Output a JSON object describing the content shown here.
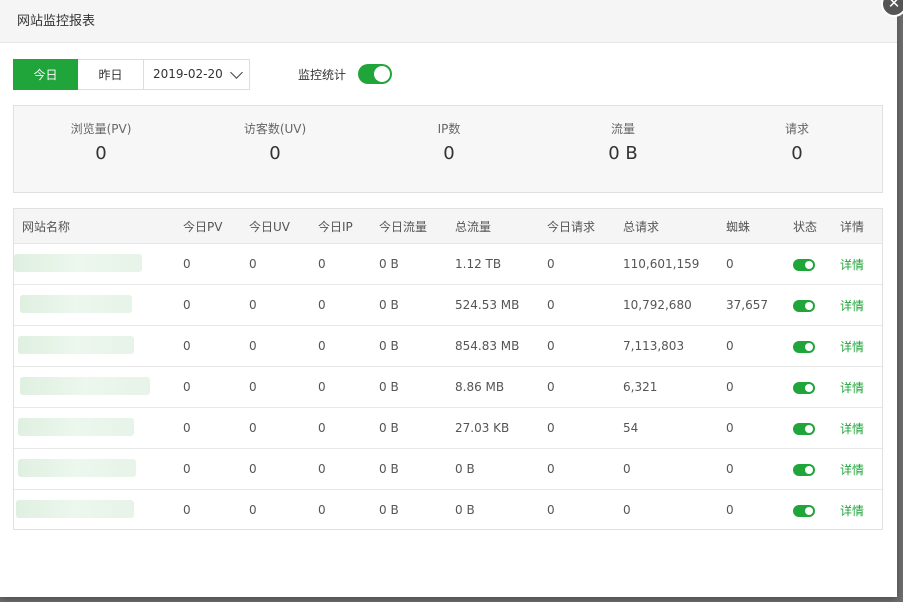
{
  "dialog": {
    "title": "网站监控报表"
  },
  "toolbar": {
    "today_label": "今日",
    "yesterday_label": "昨日",
    "date_value": "2019-02-20",
    "monitor_label": "监控统计",
    "monitor_enabled": true
  },
  "stats": [
    {
      "label": "浏览量(PV)",
      "value": "0"
    },
    {
      "label": "访客数(UV)",
      "value": "0"
    },
    {
      "label": "IP数",
      "value": "0"
    },
    {
      "label": "流量",
      "value": "0 B"
    },
    {
      "label": "请求",
      "value": "0"
    }
  ],
  "table": {
    "headers": [
      "网站名称",
      "今日PV",
      "今日UV",
      "今日IP",
      "今日流量",
      "总流量",
      "今日请求",
      "总请求",
      "蜘蛛",
      "状态",
      "详情"
    ],
    "rows": [
      {
        "pv": "0",
        "uv": "0",
        "ip": "0",
        "today_traffic": "0 B",
        "total_traffic": "1.12 TB",
        "today_requests": "0",
        "total_requests": "110,601,159",
        "spiders": "0",
        "status": true,
        "detail": "详情"
      },
      {
        "pv": "0",
        "uv": "0",
        "ip": "0",
        "today_traffic": "0 B",
        "total_traffic": "524.53 MB",
        "today_requests": "0",
        "total_requests": "10,792,680",
        "spiders": "37,657",
        "status": true,
        "detail": "详情"
      },
      {
        "pv": "0",
        "uv": "0",
        "ip": "0",
        "today_traffic": "0 B",
        "total_traffic": "854.83 MB",
        "today_requests": "0",
        "total_requests": "7,113,803",
        "spiders": "0",
        "status": true,
        "detail": "详情"
      },
      {
        "pv": "0",
        "uv": "0",
        "ip": "0",
        "today_traffic": "0 B",
        "total_traffic": "8.86 MB",
        "today_requests": "0",
        "total_requests": "6,321",
        "spiders": "0",
        "status": true,
        "detail": "详情"
      },
      {
        "pv": "0",
        "uv": "0",
        "ip": "0",
        "today_traffic": "0 B",
        "total_traffic": "27.03 KB",
        "today_requests": "0",
        "total_requests": "54",
        "spiders": "0",
        "status": true,
        "detail": "详情"
      },
      {
        "pv": "0",
        "uv": "0",
        "ip": "0",
        "today_traffic": "0 B",
        "total_traffic": "0 B",
        "today_requests": "0",
        "total_requests": "0",
        "spiders": "0",
        "status": true,
        "detail": "详情"
      },
      {
        "pv": "0",
        "uv": "0",
        "ip": "0",
        "today_traffic": "0 B",
        "total_traffic": "0 B",
        "today_requests": "0",
        "total_requests": "0",
        "spiders": "0",
        "status": true,
        "detail": "详情"
      }
    ]
  },
  "colors": {
    "accent": "#20a53a"
  },
  "icons": {
    "close": "close-icon",
    "dropdown": "chevron-down-icon"
  }
}
